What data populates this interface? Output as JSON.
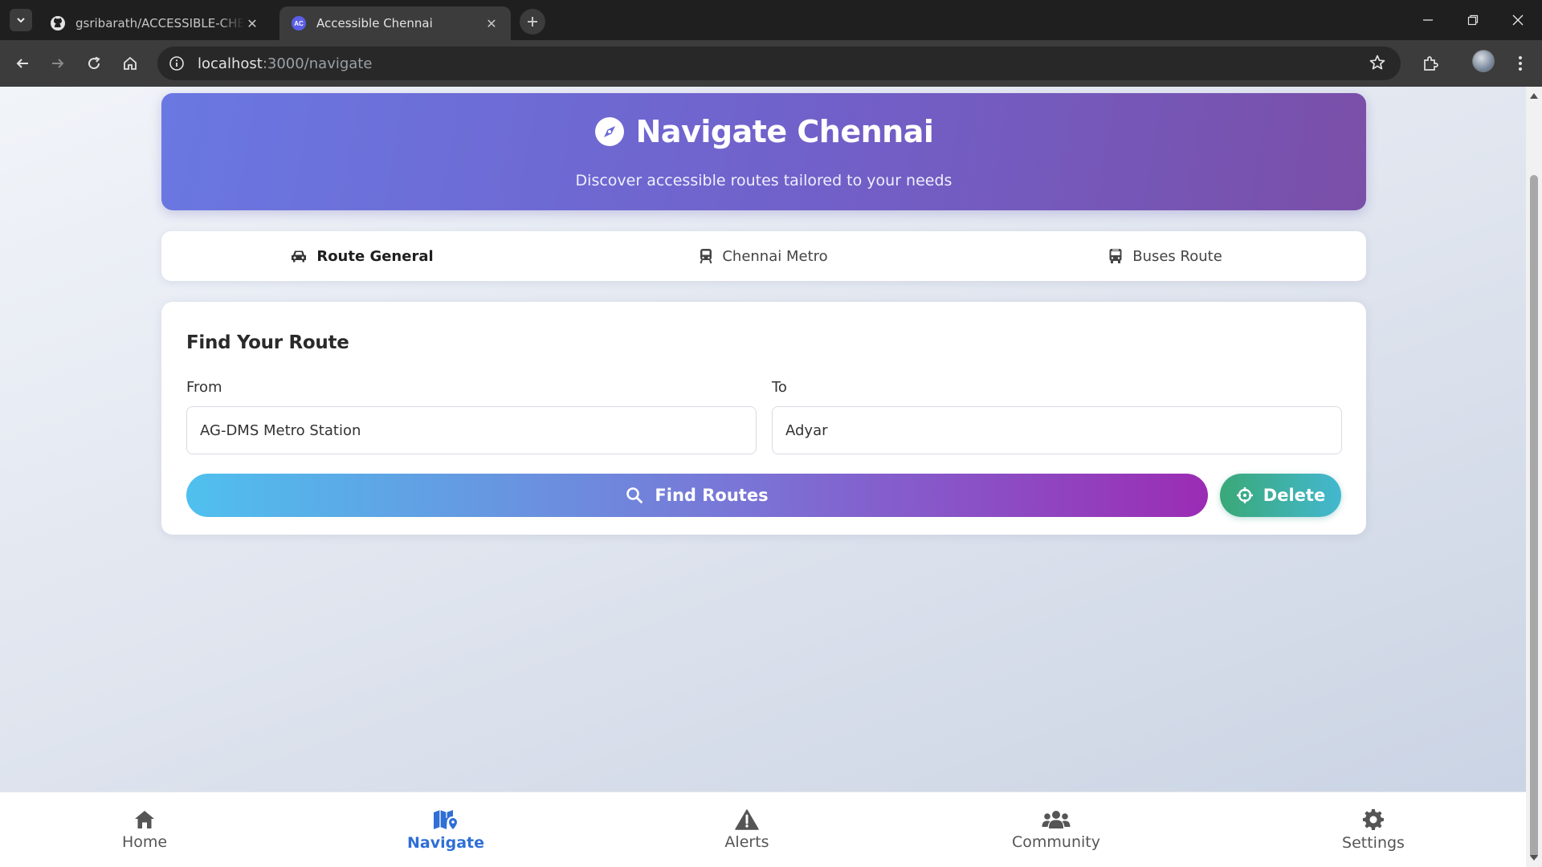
{
  "browser": {
    "tabs": [
      {
        "title": "gsribarath/ACCESSIBLE-CHENNAI",
        "favicon": "github-icon",
        "active": false
      },
      {
        "title": "Accessible Chennai",
        "favicon": "AC",
        "active": true
      }
    ],
    "url_host": "localhost",
    "url_path": ":3000/navigate"
  },
  "hero": {
    "title": "Navigate Chennai",
    "subtitle": "Discover accessible routes tailored to your needs",
    "icon": "compass-icon"
  },
  "route_tabs": [
    {
      "label": "Route General",
      "icon": "car-icon",
      "active": true
    },
    {
      "label": "Chennai Metro",
      "icon": "train-icon",
      "active": false
    },
    {
      "label": "Buses Route",
      "icon": "bus-icon",
      "active": false
    }
  ],
  "route_form": {
    "heading": "Find Your Route",
    "from_label": "From",
    "from_value": "AG-DMS Metro Station",
    "to_label": "To",
    "to_value": "Adyar",
    "find_label": "Find Routes",
    "delete_label": "Delete"
  },
  "bottom_nav": [
    {
      "label": "Home",
      "icon": "home-icon",
      "active": false
    },
    {
      "label": "Navigate",
      "icon": "map-pin-icon",
      "active": true
    },
    {
      "label": "Alerts",
      "icon": "warning-icon",
      "active": false
    },
    {
      "label": "Community",
      "icon": "users-icon",
      "active": false
    },
    {
      "label": "Settings",
      "icon": "gear-icon",
      "active": false
    }
  ],
  "colors": {
    "accent": "#2f6fd6",
    "hero_start": "#6a78e2",
    "hero_end": "#7a4fa8",
    "delete_start": "#3aa877",
    "delete_end": "#43b8d0"
  }
}
